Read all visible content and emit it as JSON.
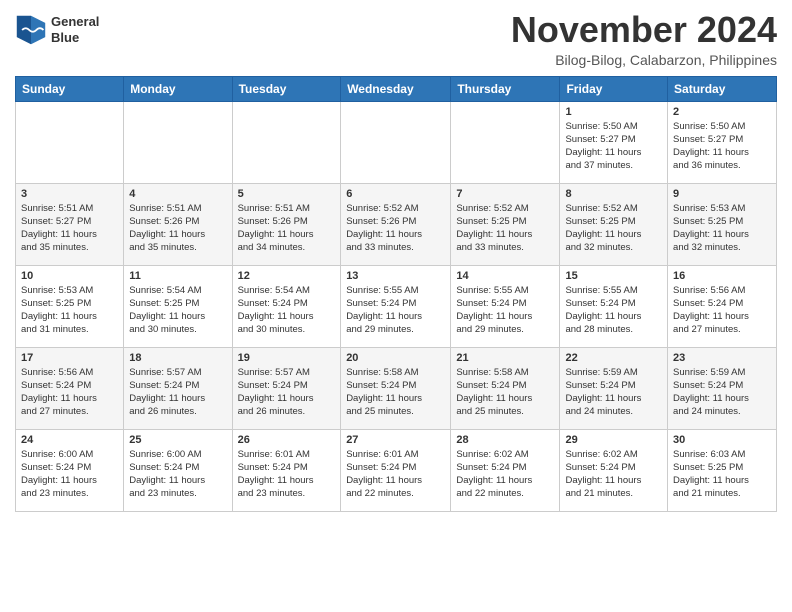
{
  "header": {
    "logo_line1": "General",
    "logo_line2": "Blue",
    "month": "November 2024",
    "location": "Bilog-Bilog, Calabarzon, Philippines"
  },
  "weekdays": [
    "Sunday",
    "Monday",
    "Tuesday",
    "Wednesday",
    "Thursday",
    "Friday",
    "Saturday"
  ],
  "weeks": [
    [
      {
        "day": "",
        "info": ""
      },
      {
        "day": "",
        "info": ""
      },
      {
        "day": "",
        "info": ""
      },
      {
        "day": "",
        "info": ""
      },
      {
        "day": "",
        "info": ""
      },
      {
        "day": "1",
        "info": "Sunrise: 5:50 AM\nSunset: 5:27 PM\nDaylight: 11 hours\nand 37 minutes."
      },
      {
        "day": "2",
        "info": "Sunrise: 5:50 AM\nSunset: 5:27 PM\nDaylight: 11 hours\nand 36 minutes."
      }
    ],
    [
      {
        "day": "3",
        "info": "Sunrise: 5:51 AM\nSunset: 5:27 PM\nDaylight: 11 hours\nand 35 minutes."
      },
      {
        "day": "4",
        "info": "Sunrise: 5:51 AM\nSunset: 5:26 PM\nDaylight: 11 hours\nand 35 minutes."
      },
      {
        "day": "5",
        "info": "Sunrise: 5:51 AM\nSunset: 5:26 PM\nDaylight: 11 hours\nand 34 minutes."
      },
      {
        "day": "6",
        "info": "Sunrise: 5:52 AM\nSunset: 5:26 PM\nDaylight: 11 hours\nand 33 minutes."
      },
      {
        "day": "7",
        "info": "Sunrise: 5:52 AM\nSunset: 5:25 PM\nDaylight: 11 hours\nand 33 minutes."
      },
      {
        "day": "8",
        "info": "Sunrise: 5:52 AM\nSunset: 5:25 PM\nDaylight: 11 hours\nand 32 minutes."
      },
      {
        "day": "9",
        "info": "Sunrise: 5:53 AM\nSunset: 5:25 PM\nDaylight: 11 hours\nand 32 minutes."
      }
    ],
    [
      {
        "day": "10",
        "info": "Sunrise: 5:53 AM\nSunset: 5:25 PM\nDaylight: 11 hours\nand 31 minutes."
      },
      {
        "day": "11",
        "info": "Sunrise: 5:54 AM\nSunset: 5:25 PM\nDaylight: 11 hours\nand 30 minutes."
      },
      {
        "day": "12",
        "info": "Sunrise: 5:54 AM\nSunset: 5:24 PM\nDaylight: 11 hours\nand 30 minutes."
      },
      {
        "day": "13",
        "info": "Sunrise: 5:55 AM\nSunset: 5:24 PM\nDaylight: 11 hours\nand 29 minutes."
      },
      {
        "day": "14",
        "info": "Sunrise: 5:55 AM\nSunset: 5:24 PM\nDaylight: 11 hours\nand 29 minutes."
      },
      {
        "day": "15",
        "info": "Sunrise: 5:55 AM\nSunset: 5:24 PM\nDaylight: 11 hours\nand 28 minutes."
      },
      {
        "day": "16",
        "info": "Sunrise: 5:56 AM\nSunset: 5:24 PM\nDaylight: 11 hours\nand 27 minutes."
      }
    ],
    [
      {
        "day": "17",
        "info": "Sunrise: 5:56 AM\nSunset: 5:24 PM\nDaylight: 11 hours\nand 27 minutes."
      },
      {
        "day": "18",
        "info": "Sunrise: 5:57 AM\nSunset: 5:24 PM\nDaylight: 11 hours\nand 26 minutes."
      },
      {
        "day": "19",
        "info": "Sunrise: 5:57 AM\nSunset: 5:24 PM\nDaylight: 11 hours\nand 26 minutes."
      },
      {
        "day": "20",
        "info": "Sunrise: 5:58 AM\nSunset: 5:24 PM\nDaylight: 11 hours\nand 25 minutes."
      },
      {
        "day": "21",
        "info": "Sunrise: 5:58 AM\nSunset: 5:24 PM\nDaylight: 11 hours\nand 25 minutes."
      },
      {
        "day": "22",
        "info": "Sunrise: 5:59 AM\nSunset: 5:24 PM\nDaylight: 11 hours\nand 24 minutes."
      },
      {
        "day": "23",
        "info": "Sunrise: 5:59 AM\nSunset: 5:24 PM\nDaylight: 11 hours\nand 24 minutes."
      }
    ],
    [
      {
        "day": "24",
        "info": "Sunrise: 6:00 AM\nSunset: 5:24 PM\nDaylight: 11 hours\nand 23 minutes."
      },
      {
        "day": "25",
        "info": "Sunrise: 6:00 AM\nSunset: 5:24 PM\nDaylight: 11 hours\nand 23 minutes."
      },
      {
        "day": "26",
        "info": "Sunrise: 6:01 AM\nSunset: 5:24 PM\nDaylight: 11 hours\nand 23 minutes."
      },
      {
        "day": "27",
        "info": "Sunrise: 6:01 AM\nSunset: 5:24 PM\nDaylight: 11 hours\nand 22 minutes."
      },
      {
        "day": "28",
        "info": "Sunrise: 6:02 AM\nSunset: 5:24 PM\nDaylight: 11 hours\nand 22 minutes."
      },
      {
        "day": "29",
        "info": "Sunrise: 6:02 AM\nSunset: 5:24 PM\nDaylight: 11 hours\nand 21 minutes."
      },
      {
        "day": "30",
        "info": "Sunrise: 6:03 AM\nSunset: 5:25 PM\nDaylight: 11 hours\nand 21 minutes."
      }
    ]
  ]
}
